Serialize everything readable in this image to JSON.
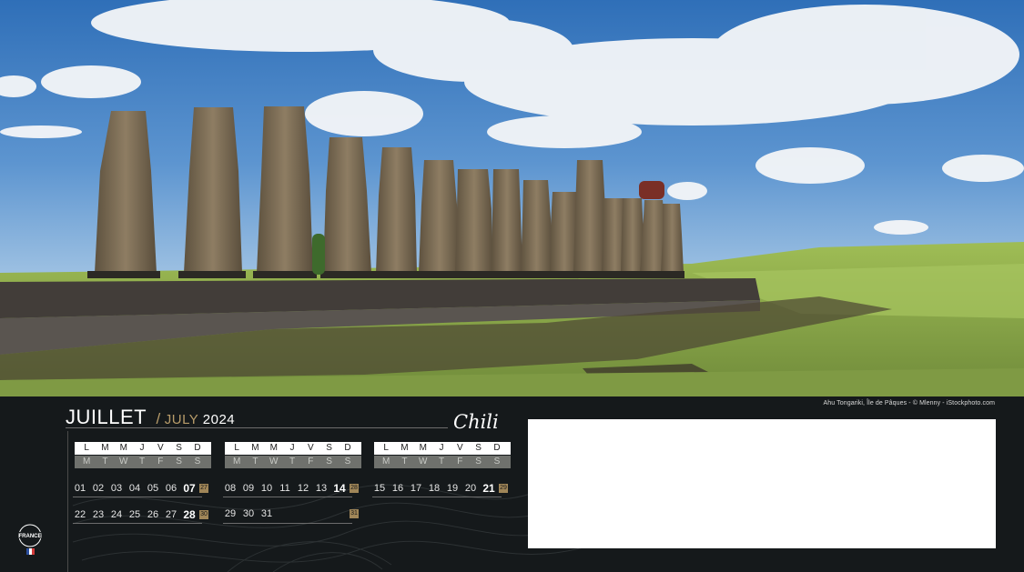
{
  "photo": {
    "subject": "moai-statues-easter-island",
    "colors": {
      "sky": "#3f7fc4",
      "cloud": "#f2f4f6",
      "grass": "#8aa54a",
      "stone": "#7a6a55",
      "platform": "#3e3a37"
    }
  },
  "credit": "Ahu Tongariki, Île de Pâques - © Mlenny - iStockphoto.com",
  "header": {
    "month_fr": "JUILLET",
    "slash": "/",
    "month_en": "JULY",
    "year": "2024",
    "country": "Chili"
  },
  "weekday_labels_fr": [
    "L",
    "M",
    "M",
    "J",
    "V",
    "S",
    "D"
  ],
  "weekday_labels_en": [
    "M",
    "T",
    "W",
    "T",
    "F",
    "S",
    "S"
  ],
  "weeks": [
    {
      "dates": [
        "01",
        "02",
        "03",
        "04",
        "05",
        "06",
        "07"
      ],
      "week_number": "27"
    },
    {
      "dates": [
        "08",
        "09",
        "10",
        "11",
        "12",
        "13",
        "14"
      ],
      "week_number": "28"
    },
    {
      "dates": [
        "15",
        "16",
        "17",
        "18",
        "19",
        "20",
        "21"
      ],
      "week_number": "29"
    },
    {
      "dates": [
        "22",
        "23",
        "24",
        "25",
        "26",
        "27",
        "28"
      ],
      "week_number": "30"
    },
    {
      "dates": [
        "29",
        "30",
        "31"
      ],
      "week_number": "31"
    }
  ],
  "logo": {
    "text": "FRANCE"
  },
  "colors": {
    "panel": "#15191b",
    "accent": "#b89c6a",
    "week_badge": "#a08658"
  }
}
